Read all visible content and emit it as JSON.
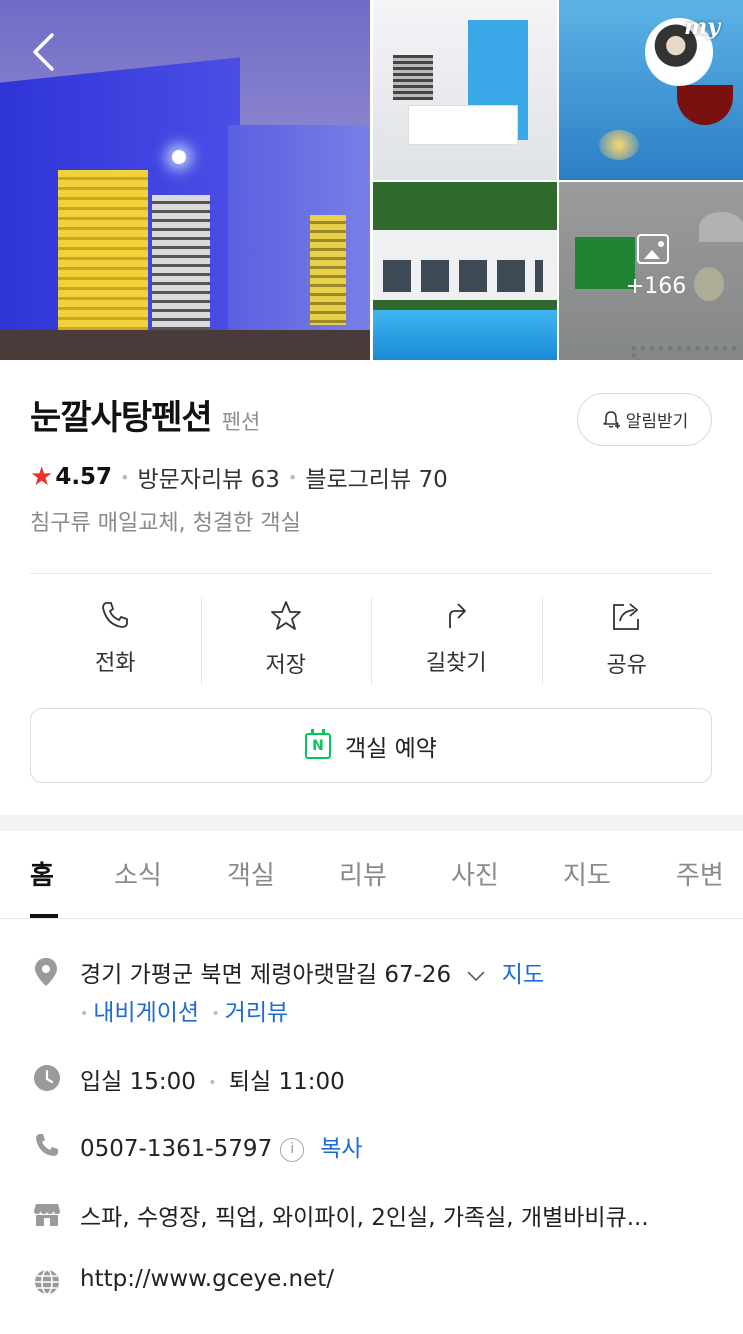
{
  "gallery": {
    "more_count": "+166",
    "avatar_text": "my"
  },
  "place": {
    "name": "눈깔사탕펜션",
    "category": "펜션",
    "notify_label": "알림받기",
    "rating": "4.57",
    "visitor_reviews": "방문자리뷰 63",
    "blog_reviews": "블로그리뷰 70",
    "summary": "침구류 매일교체, 청결한 객실"
  },
  "actions": [
    {
      "label": "전화",
      "icon": "phone-icon"
    },
    {
      "label": "저장",
      "icon": "star-icon"
    },
    {
      "label": "길찾기",
      "icon": "directions-icon"
    },
    {
      "label": "공유",
      "icon": "share-icon"
    }
  ],
  "reserve": {
    "label": "객실 예약",
    "badge": "N"
  },
  "tabs": [
    "홈",
    "소식",
    "객실",
    "리뷰",
    "사진",
    "지도",
    "주변"
  ],
  "info": {
    "address": "경기 가평군 북면 제령아랫말길 67-26",
    "map_link": "지도",
    "navigation_link": "내비게이션",
    "streetview_link": "거리뷰",
    "checkin": "입실 15:00",
    "checkout": "퇴실 11:00",
    "phone": "0507-1361-5797",
    "copy_link": "복사",
    "amenities": "스파, 수영장, 픽업, 와이파이, 2인실, 가족실, 개별바비큐...",
    "website": "http://www.gceye.net/"
  },
  "colors": {
    "accent": "#03c75a",
    "link": "#1c6bd6",
    "star": "#e8322c"
  }
}
